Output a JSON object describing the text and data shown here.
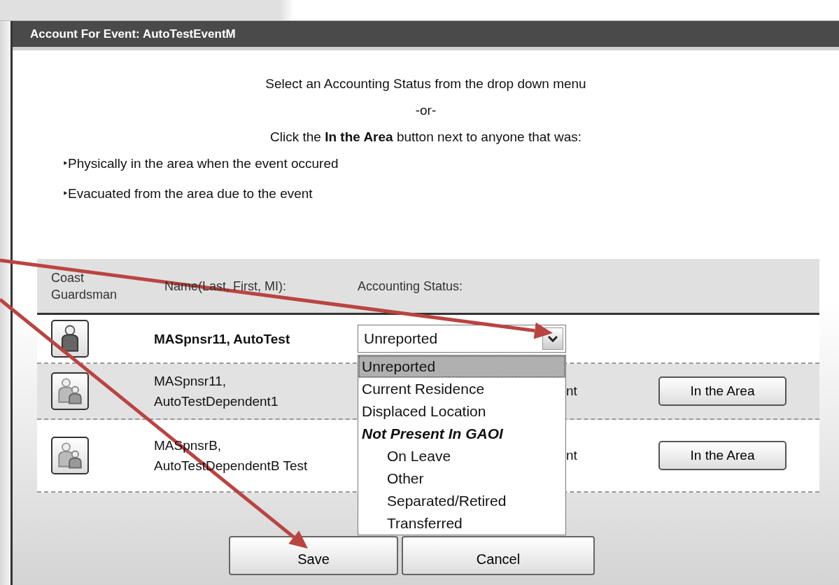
{
  "dialog": {
    "title": "Account For Event: AutoTestEventM"
  },
  "instructions": {
    "lines": [
      "Select an Accounting Status from the drop down menu",
      "-or-",
      "Click the **In the Area** button next to anyone that was:"
    ],
    "bullets": [
      {
        "marker": "‣",
        "text": "Physically in the area when the event occured"
      },
      {
        "marker": "‣",
        "text": "Evacuated from the area due to the event"
      }
    ]
  },
  "table": {
    "columns": [
      "Coast Guardsman",
      "Name(Last, First, MI):",
      "Accounting Status:"
    ],
    "rows": [
      {
        "kind": "member",
        "shaded": false,
        "name": "MASpnsr11, AutoTest",
        "status_select": {
          "value": "Unreported",
          "expanded": true
        }
      },
      {
        "kind": "dependent",
        "shaded": true,
        "name": "MASpnsr11, AutoTestDependent1",
        "status": "nt",
        "button": "In the Area"
      },
      {
        "kind": "dependent",
        "shaded": false,
        "name": "MASpnsrB, AutoTestDependentB Test",
        "status": "nt",
        "button": "In the Area"
      }
    ]
  },
  "dropdown_options": [
    {
      "kind": "option",
      "label": "Unreported",
      "selected": true
    },
    {
      "kind": "option",
      "label": "Current Residence",
      "selected": false
    },
    {
      "kind": "option",
      "label": "Displaced Location",
      "selected": false
    },
    {
      "kind": "group",
      "label": "Not Present In GAOI",
      "selected": false
    },
    {
      "kind": "suboption",
      "label": "On Leave",
      "selected": false
    },
    {
      "kind": "suboption",
      "label": "Other",
      "selected": false
    },
    {
      "kind": "suboption",
      "label": "Separated/Retired",
      "selected": false
    },
    {
      "kind": "suboption",
      "label": "Transferred",
      "selected": false
    }
  ],
  "buttons": [
    {
      "label": "Save"
    },
    {
      "label": "Cancel"
    }
  ]
}
